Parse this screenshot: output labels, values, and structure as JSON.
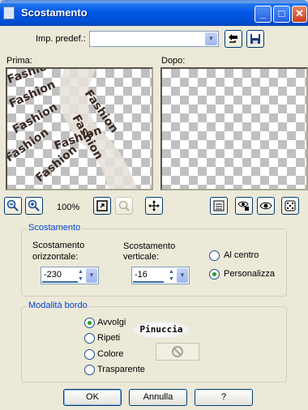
{
  "window": {
    "title": "Scostamento",
    "minimize_glyph": "_",
    "maximize_glyph": "□",
    "close_glyph": "✕"
  },
  "preset": {
    "label": "Imp. predef.:",
    "value": "",
    "icons": [
      "reset-icon",
      "save-icon"
    ]
  },
  "previews": {
    "before_label": "Prima:",
    "after_label": "Dopo:",
    "sample_text": "Fashion"
  },
  "zoom": {
    "level": "100%",
    "icons": [
      "zoom-out-icon",
      "zoom-in-icon",
      "fit-to-window-icon",
      "zoom-disabled-icon",
      "pan-icon"
    ]
  },
  "toolbar_icons": [
    "properties-icon",
    "eye-hand-icon",
    "eye-icon",
    "dice-icon"
  ],
  "offset": {
    "group_title": "Scostamento",
    "horizontal_label": "Scostamento orizzontale:",
    "horizontal_value": "-230",
    "vertical_label": "Scostamento verticale:",
    "vertical_value": "-16",
    "center_label": "Al centro",
    "custom_label": "Personalizza",
    "selected": "custom"
  },
  "edge_mode": {
    "group_title": "Modalità bordo",
    "options": [
      "Avvolgi",
      "Ripeti",
      "Colore",
      "Trasparente"
    ],
    "selected": "Avvolgi",
    "logo_text": "Pinuccia"
  },
  "buttons": {
    "ok": "OK",
    "cancel": "Annulla",
    "help": "?"
  },
  "colors": {
    "title_bar": "#0054e3",
    "group_title": "#0046d5",
    "face": "#ece9d8"
  }
}
